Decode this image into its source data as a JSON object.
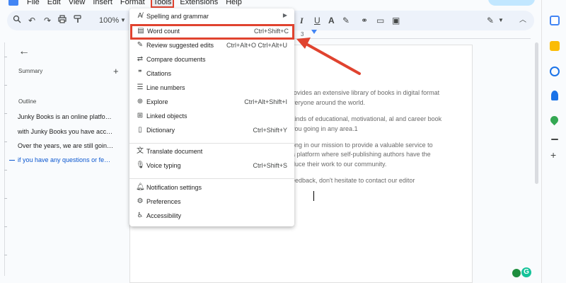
{
  "menubar": {
    "items": [
      "File",
      "Edit",
      "View",
      "Insert",
      "Format",
      "Tools",
      "Extensions",
      "Help"
    ]
  },
  "toolbar": {
    "zoom": "100%",
    "icons": [
      "search-icon",
      "undo-icon",
      "redo-icon",
      "print-icon",
      "paint-format-icon"
    ]
  },
  "ruler": {
    "marker_number": "3"
  },
  "outline_panel": {
    "summary_label": "Summary",
    "outline_label": "Outline",
    "items": [
      "Junky Books is an online platfo…",
      "with Junky Books you have acc…",
      "Over the years, we are still goin…",
      "if you have any questions or fe…"
    ],
    "active_index": 3
  },
  "document": {
    "lines": [
      "rovides an extensive library of books in digital format",
      "veryone around the world.",
      "kinds of educational, motivational, al and career book",
      "you going in any area.1",
      "ong in our mission to provide a valuable service to",
      "a platform where self-publishing authors have the",
      "duce their work to our community.",
      "eedback, don't hesitate to contact our editor"
    ]
  },
  "tools_menu": {
    "items": [
      {
        "icon": "spellcheck-icon",
        "label": "Spelling and grammar",
        "shortcut": "",
        "submenu": true
      },
      {
        "icon": "word-count-icon",
        "label": "Word count",
        "shortcut": "Ctrl+Shift+C",
        "highlight": true
      },
      {
        "icon": "review-edits-icon",
        "label": "Review suggested edits",
        "shortcut": "Ctrl+Alt+O Ctrl+Alt+U"
      },
      {
        "icon": "compare-icon",
        "label": "Compare documents",
        "shortcut": ""
      },
      {
        "icon": "quote-icon",
        "label": "Citations",
        "shortcut": ""
      },
      {
        "icon": "line-numbers-icon",
        "label": "Line numbers",
        "shortcut": ""
      },
      {
        "icon": "explore-icon",
        "label": "Explore",
        "shortcut": "Ctrl+Alt+Shift+I"
      },
      {
        "icon": "linked-objects-icon",
        "label": "Linked objects",
        "shortcut": ""
      },
      {
        "icon": "dictionary-icon",
        "label": "Dictionary",
        "shortcut": "Ctrl+Shift+Y"
      },
      {
        "icon": "translate-icon",
        "label": "Translate document",
        "shortcut": ""
      },
      {
        "icon": "microphone-icon",
        "label": "Voice typing",
        "shortcut": "Ctrl+Shift+S"
      },
      {
        "icon": "bell-icon",
        "label": "Notification settings",
        "shortcut": ""
      },
      {
        "icon": "preferences-icon",
        "label": "Preferences",
        "shortcut": ""
      },
      {
        "icon": "accessibility-icon",
        "label": "Accessibility",
        "shortcut": ""
      }
    ]
  },
  "colors": {
    "highlight": "#e0432f",
    "accent": "#0b57d0"
  }
}
